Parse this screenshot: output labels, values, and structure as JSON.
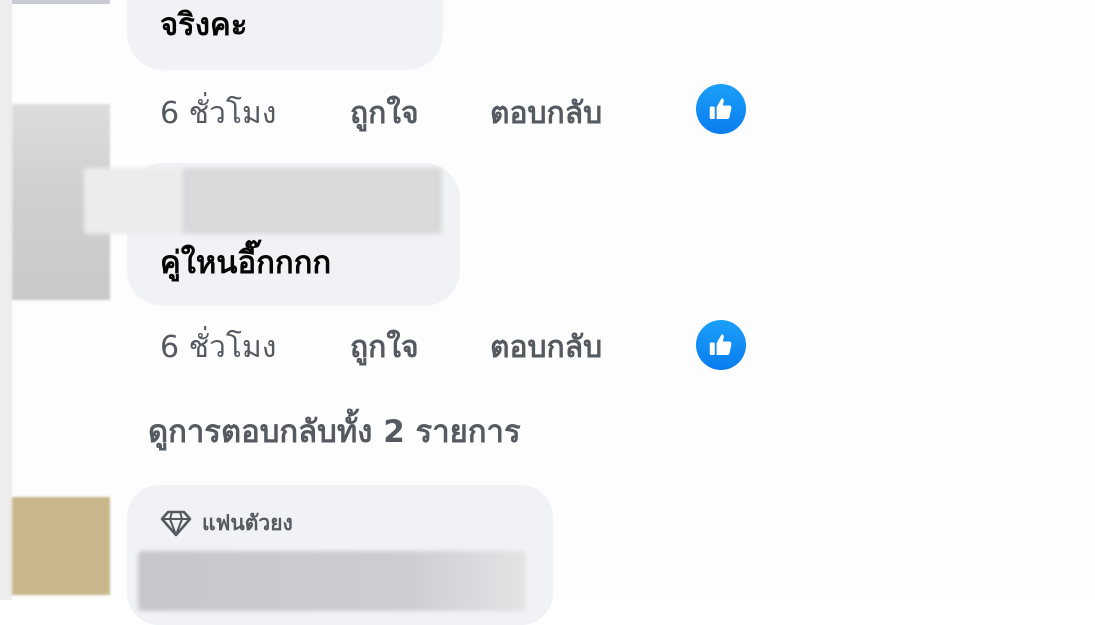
{
  "comments": [
    {
      "text": "จริงคะ",
      "time": "6 ชั่วโมง",
      "like_label": "ถูกใจ",
      "reply_label": "ตอบกลับ",
      "reaction_icon": "thumbs-up-icon"
    },
    {
      "text": "คู่ใหนอี๊กกกก",
      "time": "6 ชั่วโมง",
      "like_label": "ถูกใจ",
      "reply_label": "ตอบกลับ",
      "reaction_icon": "thumbs-up-icon"
    }
  ],
  "view_replies": "ดูการตอบกลับทั้ง 2 รายการ",
  "next_comment": {
    "badge_icon": "diamond-icon",
    "badge_label": "แฟนตัวยง"
  },
  "colors": {
    "bubble": "#f0f2f5",
    "secondary_text": "#555a61",
    "like_blue": "#0a7cf0"
  }
}
